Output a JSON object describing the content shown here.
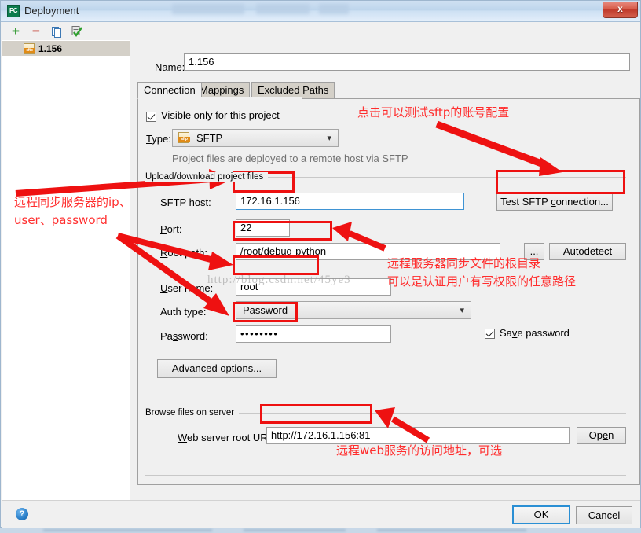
{
  "window": {
    "title": "Deployment",
    "app_icon": "pycharm-icon",
    "close_label": "x"
  },
  "left_pane": {
    "toolbar": [
      {
        "name": "add-button",
        "glyph": "+"
      },
      {
        "name": "remove-button",
        "glyph": "−"
      },
      {
        "name": "copy-button",
        "glyph": "❐"
      },
      {
        "name": "set-default-button",
        "glyph": "✔"
      }
    ],
    "servers": [
      {
        "label": "1.156",
        "icon": "sftp-icon",
        "selected": true
      }
    ]
  },
  "form": {
    "name_label": "Name:",
    "name_value": "1.156",
    "tabs": [
      {
        "label": "Connection",
        "active": true
      },
      {
        "label": "Mappings",
        "active": false
      },
      {
        "label": "Excluded Paths",
        "active": false
      }
    ],
    "visible_only_label": "Visible only for this project",
    "visible_only_checked": true,
    "type_label": "Type:",
    "type_value": "SFTP",
    "type_hint": "Project files are deployed to a remote host via SFTP",
    "upload_group_label": "Upload/download project files",
    "sftp_host_label": "SFTP host:",
    "sftp_host_value": "172.16.1.156",
    "test_connection_label": "Test SFTP connection...",
    "port_label": "Port:",
    "port_value": "22",
    "root_path_label": "Root path:",
    "root_path_value": "/root/debug-python",
    "browse_label": "...",
    "autodetect_label": "Autodetect",
    "user_name_label": "User name:",
    "user_name_value": "root",
    "auth_type_label": "Auth type:",
    "auth_type_value": "Password",
    "password_label": "Password:",
    "password_value": "••••••••",
    "save_password_label": "Save password",
    "save_password_checked": true,
    "advanced_options_label": "Advanced options...",
    "browse_group_label": "Browse files on server",
    "web_url_label": "Web server root URL:",
    "web_url_value": "http://172.16.1.156:81",
    "open_label": "Open"
  },
  "footer": {
    "help_glyph": "?",
    "ok_label": "OK",
    "cancel_label": "Cancel"
  },
  "annotations": [
    {
      "id": "test-connection-note",
      "text": "点击可以测试sftp的账号配置"
    },
    {
      "id": "server-credentials-note-line1",
      "text": "远程同步服务器的ip、"
    },
    {
      "id": "server-credentials-note-line2",
      "text": "user、password"
    },
    {
      "id": "root-path-note-line1",
      "text": "远程服务器同步文件的根目录"
    },
    {
      "id": "root-path-note-line2",
      "text": "可以是认证用户有写权限的任意路径"
    },
    {
      "id": "web-url-note",
      "text": "远程web服务的访问地址，可选"
    }
  ],
  "watermark": {
    "text": "http://blog.csdn.net/45ye3"
  },
  "colors": {
    "annotation_red": "#ff2d2d",
    "highlight_box_red": "#ee1111",
    "accent_blue": "#2a8fd4",
    "title_gradient_top": "#cfe0f2"
  }
}
